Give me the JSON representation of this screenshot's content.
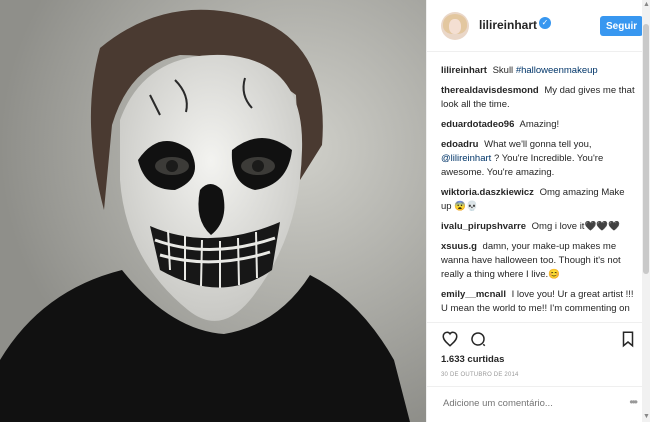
{
  "post": {
    "username": "lilireinhart",
    "verified": true,
    "follow_label": "Seguir",
    "likes": "1.633 curtidas",
    "date": "30 DE OUTUBRO DE 2014",
    "add_comment_placeholder": "Adicione um comentário...",
    "more_label": "•••"
  },
  "comments": [
    {
      "user": "lilireinhart",
      "text": "Skull ",
      "tag": "#halloweenmakeup"
    },
    {
      "user": "therealdavisdesmond",
      "text": "My dad gives me that look all the time."
    },
    {
      "user": "eduardotadeo96",
      "text": "Amazing!"
    },
    {
      "user": "edoadru",
      "text": "What we'll gonna tell you, ",
      "tag": "@lilireinhart",
      "text2": " ? You're Incredible. You're awesome. You're amazing."
    },
    {
      "user": "wiktoria.daszkiewicz",
      "text": "Omg amazing Make up 😨💀"
    },
    {
      "user": "ivalu_pirupshvarre",
      "text": "Omg i love it🖤🖤🖤"
    },
    {
      "user": "xsuus.g",
      "text": "damn, your make-up makes me wanna have halloween too. Though it's not really a thing where I live.😊"
    },
    {
      "user": "emily__mcnall",
      "text": "I love you! Ur a great artist !!! U mean the world to me!! I'm commenting on this picture because u don't have a lot of comments so I was hoping u would see it. If u have please dm"
    }
  ],
  "icons": {
    "heart": "heart-icon",
    "comment": "comment-icon",
    "bookmark": "bookmark-icon",
    "verified": "verified-badge-icon",
    "more": "more-options-icon"
  },
  "colors": {
    "accent": "#3897f0",
    "text": "#262626",
    "muted": "#999999",
    "border": "#efefef"
  }
}
